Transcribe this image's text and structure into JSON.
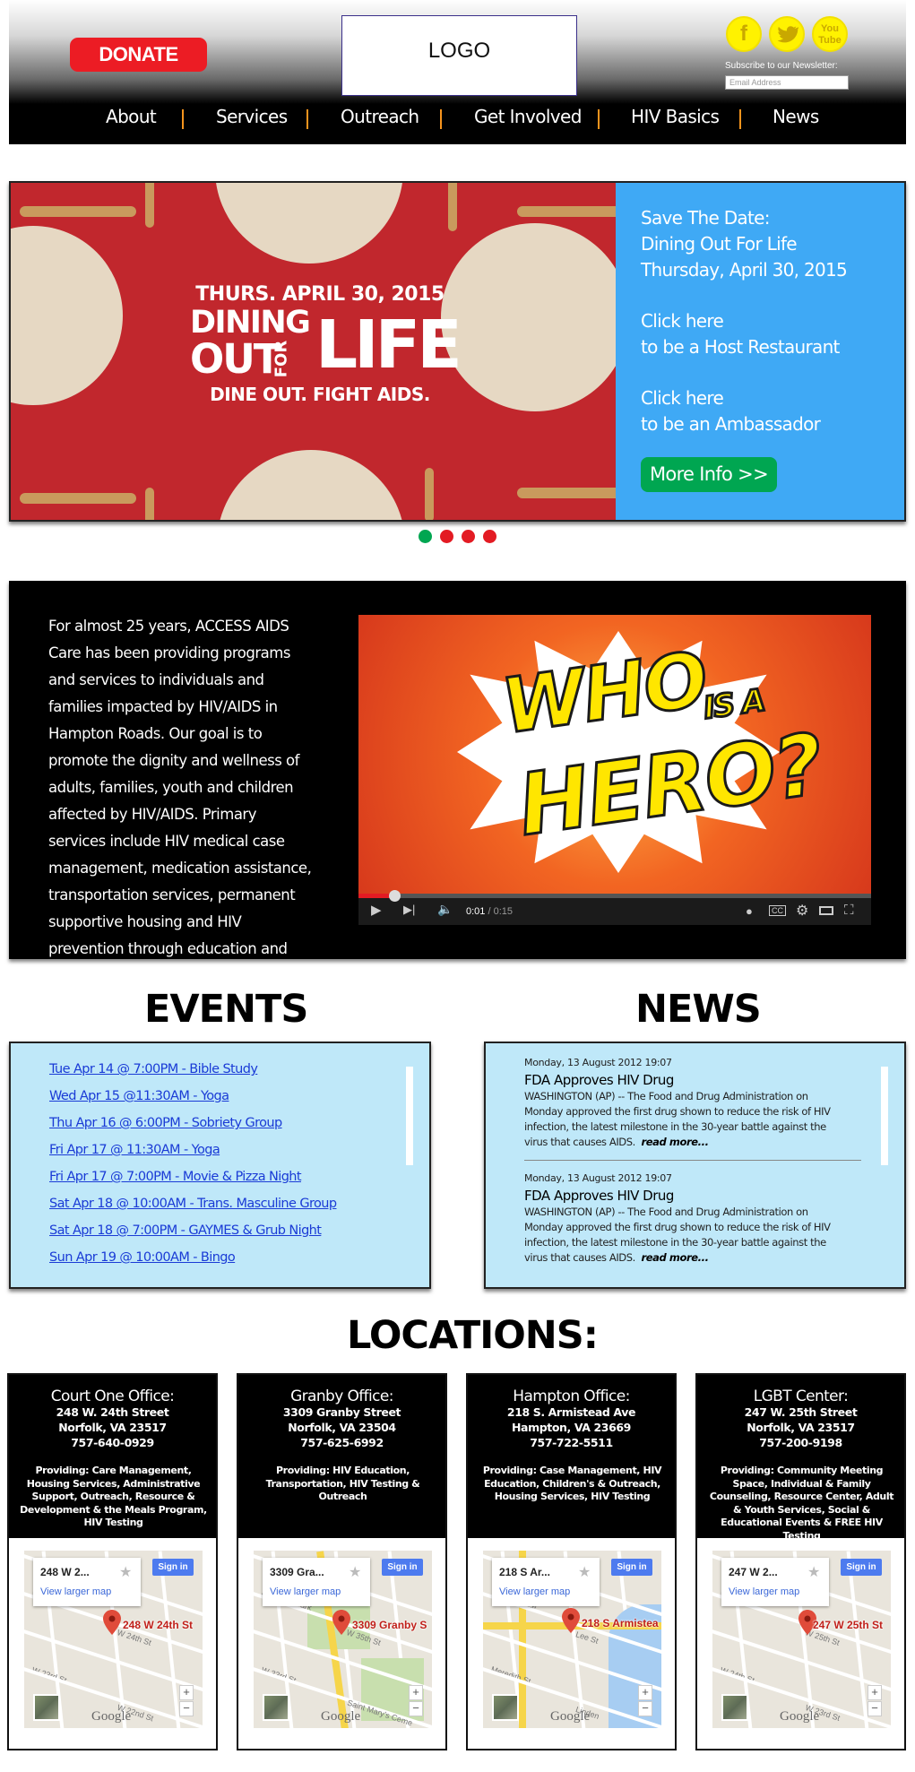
{
  "header": {
    "donate_label": "DONATE",
    "logo_label": "LOGO",
    "social": [
      {
        "icon": "facebook-icon",
        "glyph": "f"
      },
      {
        "icon": "twitter-icon",
        "glyph": "t"
      },
      {
        "icon": "youtube-icon",
        "glyph": "You Tube"
      }
    ],
    "newsletter_label": "Subscribe to our Newsletter:",
    "newsletter_placeholder": "Email Address"
  },
  "nav": {
    "items": [
      "About",
      "Services",
      "Outreach",
      "Get Involved",
      "HIV Basics",
      "News"
    ]
  },
  "hero": {
    "image_text": {
      "date": "THURS. APRIL 30, 2015",
      "line1": "DINING",
      "line2_out": "OUT",
      "line2_for": "FOR",
      "line2_life": "LIFE",
      "tagline": "DINE OUT. FIGHT AIDS."
    },
    "panel": {
      "save_the_date": "Save The Date:",
      "event_name": "Dining Out For Life",
      "event_date": "Thursday, April 30, 2015",
      "click_here_1": "Click here",
      "host_text": "to be a Host Restaurant",
      "click_here_2": "Click here",
      "ambassador_text": "to be an Ambassador",
      "more_info": "More Info >>"
    },
    "slides": 4,
    "active_slide": 1
  },
  "about": {
    "text": "For almost 25 years, ACCESS AIDS Care has been providing programs and services to individuals and families impacted by HIV/AIDS in Hampton Roads. Our goal is to promote the dignity and wellness of adults, families, youth and children affected by HIV/AIDS. Primary services include HIV medical case management, medication assistance, transportation services, permanent supportive housing and HIV prevention through education and testing.",
    "video": {
      "word1": "WHO",
      "word2": "IS A",
      "word3": "HERO?",
      "time_current": "0:01",
      "time_total": "/ 0:15",
      "progress": 0.07
    }
  },
  "events": {
    "title": "EVENTS",
    "items": [
      "Tue Apr 14 @ 7:00PM - Bible Study",
      "Wed Apr 15 @11:30AM - Yoga",
      "Thu Apr 16 @ 6:00PM - Sobriety Group",
      "Fri Apr 17 @ 11:30AM - Yoga",
      "Fri Apr 17 @ 7:00PM  - Movie & Pizza Night",
      "Sat Apr 18 @ 10:00AM - Trans. Masculine Group",
      "Sat Apr 18 @ 7:00PM - GAYMES & Grub Night",
      "Sun Apr 19 @ 10:00AM - Bingo"
    ]
  },
  "news": {
    "title": "NEWS",
    "items": [
      {
        "date": "Monday, 13 August 2012 19:07",
        "headline": "FDA Approves HIV Drug",
        "body": "WASHINGTON (AP) -- The Food and Drug Administration on Monday approved the first drug shown to reduce the risk of HIV infection, the latest milestone in the 30-year battle against the virus that causes AIDS.",
        "more": "read more..."
      },
      {
        "date": "Monday, 13 August 2012 19:07",
        "headline": "FDA Approves HIV Drug",
        "body": "WASHINGTON (AP) -- The Food and Drug Administration on Monday approved the first drug shown to reduce the risk of HIV infection, the latest milestone in the 30-year battle against the virus that causes AIDS.",
        "more": "read more..."
      }
    ]
  },
  "locations": {
    "title": "LOCATIONS:",
    "cards": [
      {
        "name": "Court One Office:",
        "street": "248 W. 24th Street",
        "city": "Norfolk, VA 23517",
        "phone": "757-640-0929",
        "providing": "Providing: Care Management, Housing Services, Administrative Support, Outreach, Resource & Development & the Meals Program, HIV Testing",
        "map_addr": "248 W 2...",
        "map_label": "248 W 24th St",
        "view_larger": "View larger map",
        "sign_in": "Sign in",
        "streets": [
          "W 25th St",
          "W 24th St",
          "W 23rd St",
          "W 22nd St"
        ]
      },
      {
        "name": "Granby Office:",
        "street": "3309 Granby Street",
        "city": "Norfolk, VA 23504",
        "phone": "757-625-6992",
        "providing": "Providing: HIV Education, Transportation, HIV Testing & Outreach",
        "map_addr": "3309 Gra...",
        "map_label": "3309 Granby S",
        "view_larger": "View larger map",
        "sign_in": "Sign in",
        "streets": [
          "Lafayette Park",
          "W 35th St",
          "W 33rd St",
          "Saint Mary's Ceme"
        ]
      },
      {
        "name": "Hampton Office:",
        "street": "218 S. Armistead Ave",
        "city": "Hampton, VA 23669",
        "phone": "757-722-5511",
        "providing": "Providing: Case Management, HIV Education, Children's & Outreach, Housing Services, HIV Testing",
        "map_addr": "218 S Ar...",
        "map_label": "218 S Armistea",
        "view_larger": "View larger map",
        "sign_in": "Sign in",
        "streets": [
          "Virgini Space",
          "Lee St",
          "Meredith St",
          "Linden"
        ]
      },
      {
        "name": "LGBT Center:",
        "street": "247 W. 25th Street",
        "city": "Norfolk, VA 23517",
        "phone": "757-200-9198",
        "providing": "Providing: Community Meeting Space, Individual & Family Counseling, Resource Center, Adult & Youth Services, Social & Educational Events & FREE HIV Testing",
        "map_addr": "247 W 2...",
        "map_label": "247 W 25th St",
        "view_larger": "View larger map",
        "sign_in": "Sign in",
        "streets": [
          "W 26th St",
          "W 25th St",
          "W 24th St",
          "W 23rd St"
        ]
      }
    ]
  },
  "colors": {
    "donate": "#ec1c24",
    "panel": "#3fa9f5",
    "more_info": "#00a651",
    "box": "#bfe8f9",
    "link": "#1a3bd6",
    "nav_separator": "#f7941d",
    "dot_active": "#00a651",
    "dot_inactive": "#e31b23"
  }
}
